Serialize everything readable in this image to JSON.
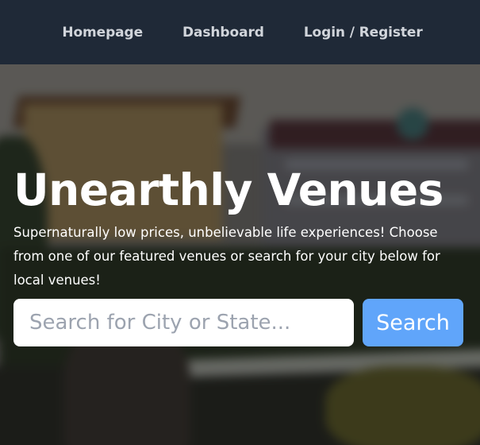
{
  "nav": {
    "items": [
      {
        "label": "Homepage"
      },
      {
        "label": "Dashboard"
      },
      {
        "label": "Login / Register"
      }
    ]
  },
  "hero": {
    "title": "Unearthly Venues",
    "subtitle": "Supernaturally low prices, unbelievable life experiences! Choose from one of our featured venues or search for your city below for local venues!"
  },
  "search": {
    "placeholder": "Search for City or State...",
    "value": "",
    "button_label": "Search"
  },
  "colors": {
    "nav_bg": "#1f2937",
    "nav_text": "#d1d5db",
    "accent": "#60a5fa",
    "hero_text": "#ffffff"
  }
}
